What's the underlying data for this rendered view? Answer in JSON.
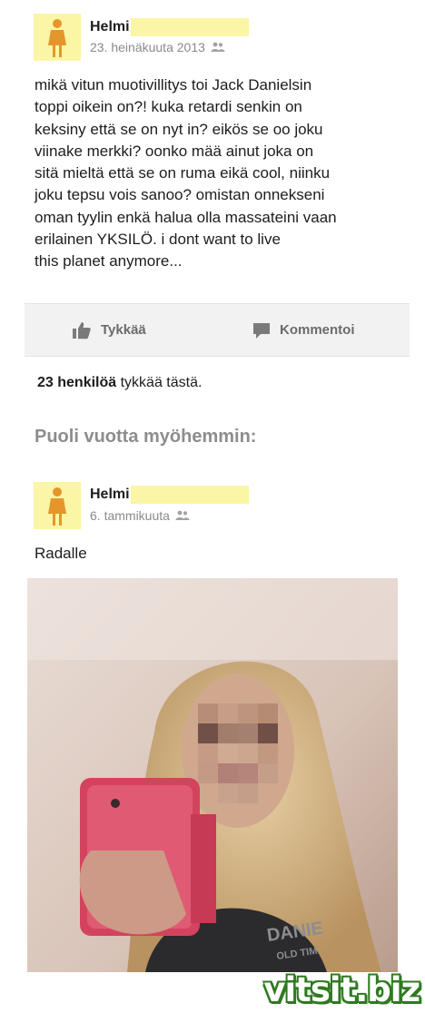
{
  "post1": {
    "author": "Helmi",
    "date": "23. heinäkuuta 2013",
    "privacy_icon": "friends-icon",
    "text": "mikä vitun muotivillitys toi Jack Danielsin\ntoppi oikein on?! kuka retardi senkin on\nkeksiny että se on nyt in? eikös se oo joku\nviinake merkki? oonko mää ainut joka on\nsitä mieltä että se on ruma eikä cool, niinku\njoku tepsu vois sanoo? omistan onnekseni\noman tyylin enkä halua olla massateini vaan\nerilainen YKSILÖ. i dont want to live\nthis planet anymore...",
    "like_label": "Tykkää",
    "comment_label": "Kommentoi",
    "likes_count": "23 henkilöä",
    "likes_suffix": "tykkää tästä."
  },
  "caption": "Puoli vuotta myöhemmin:",
  "post2": {
    "author": "Helmi",
    "date": "6. tammikuuta",
    "privacy_icon": "friends-icon",
    "text": "Radalle"
  },
  "watermark": "vitsit.biz",
  "colors": {
    "highlight": "#fbf5a6",
    "avatar_figure": "#e5962a",
    "action_bar": "#f2f2f2",
    "watermark_outline": "#2e7a20"
  }
}
